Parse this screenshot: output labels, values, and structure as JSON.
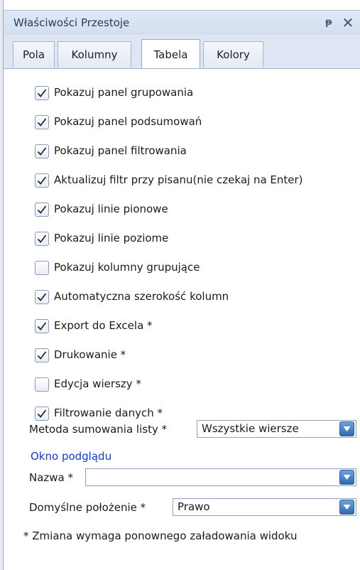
{
  "window": {
    "title": "Właściwości Przestoje",
    "pin_glyph": "ᵽ",
    "close_glyph": "✕"
  },
  "tabs": [
    {
      "label": "Pola",
      "active": false
    },
    {
      "label": "Kolumny",
      "active": false
    },
    {
      "label": "Tabela",
      "active": true
    },
    {
      "label": "Kolory",
      "active": false
    }
  ],
  "options": [
    {
      "label": "Pokazuj panel grupowania",
      "checked": true
    },
    {
      "label": "Pokazuj panel podsumowań",
      "checked": true
    },
    {
      "label": "Pokazuj panel filtrowania",
      "checked": true
    },
    {
      "label": "Aktualizuj filtr przy pisanu(nie czekaj na Enter)",
      "checked": true
    },
    {
      "label": "Pokazuj linie pionowe",
      "checked": true
    },
    {
      "label": "Pokazuj linie poziome",
      "checked": true
    },
    {
      "label": "Pokazuj kolumny grupujące",
      "checked": false
    },
    {
      "label": "Automatyczna szerokość kolumn",
      "checked": true
    },
    {
      "label": "Export do Excela *",
      "checked": true
    },
    {
      "label": "Drukowanie *",
      "checked": true
    },
    {
      "label": "Edycja wierszy *",
      "checked": false
    },
    {
      "label": "Filtrowanie danych *",
      "checked": true
    }
  ],
  "sum_method": {
    "label": "Metoda sumowania listy *",
    "value": "Wszystkie wiersze"
  },
  "preview": {
    "section_title": "Okno podglądu",
    "name_label": "Nazwa *",
    "name_value": "",
    "position_label": "Domyślne położenie *",
    "position_value": "Prawo"
  },
  "footer_note": "* Zmiana wymaga ponownego załadowania widoku",
  "colors": {
    "accent_link": "#1438e8",
    "checkbox_check": "#1c2a3a",
    "dropdown_button": "#2f6bb1"
  }
}
